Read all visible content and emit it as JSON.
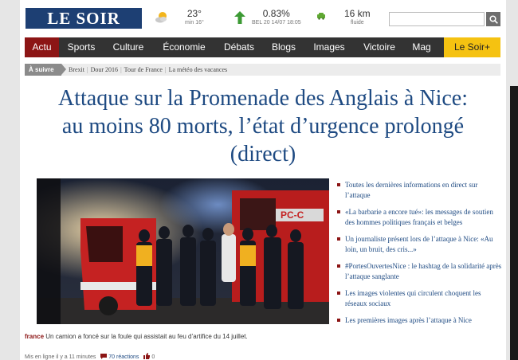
{
  "header": {
    "logo": "LE SOIR",
    "weather": {
      "temp": "23°",
      "min": "min 16°",
      "icon": "sun-cloud-icon"
    },
    "bourse": {
      "value": "0.83%",
      "label": "BEL 20 14/07 18:05",
      "icon": "arrow-up-icon"
    },
    "traffic": {
      "value": "16 km",
      "label": "fluide",
      "icon": "car-icon"
    },
    "search": {
      "placeholder": "",
      "value": ""
    }
  },
  "nav": {
    "items": [
      {
        "label": "Actu"
      },
      {
        "label": "Sports"
      },
      {
        "label": "Culture"
      },
      {
        "label": "Économie"
      },
      {
        "label": "Débats"
      },
      {
        "label": "Blogs"
      },
      {
        "label": "Images"
      },
      {
        "label": "Victoire"
      },
      {
        "label": "Mag"
      },
      {
        "label": "Le Soir+"
      }
    ]
  },
  "suivre": {
    "label": "À suivre",
    "links": [
      "Brexit",
      "Dour 2016",
      "Tour de France",
      "La météo des vacances"
    ]
  },
  "article": {
    "title_line1": "Attaque sur la Promenade des Anglais à Nice:",
    "title_line2": "au moins 80 morts, l’état d’urgence prolongé",
    "title_line3": "(direct)",
    "caption_source": "france",
    "caption_text": "Un camion a foncé sur la foule qui assistait au feu d’artifice du 14 juillet.",
    "published": "Mis en ligne il y a 11 minutes",
    "reactions": "70 réactions",
    "likes": "0",
    "truck_sign": "PC-C"
  },
  "related": [
    "Toutes les dernières informations en direct sur l’attaque",
    "«La barbarie a encore tué»: les messages de soutien des hommes politiques français et belges",
    "Un journaliste présent lors de l’attaque à Nice: «Au loin, un bruit, des cris...»",
    "#PortesOuvertesNice : le hashtag de la solidarité après l’attaque sanglante",
    "Les images violentes qui circulent choquent les réseaux sociaux",
    "Les premières images après l’attaque à Nice"
  ],
  "colors": {
    "brand": "#1d3f73",
    "accent": "#8c1515",
    "headline": "#1e4a82",
    "plus": "#f5c211"
  }
}
